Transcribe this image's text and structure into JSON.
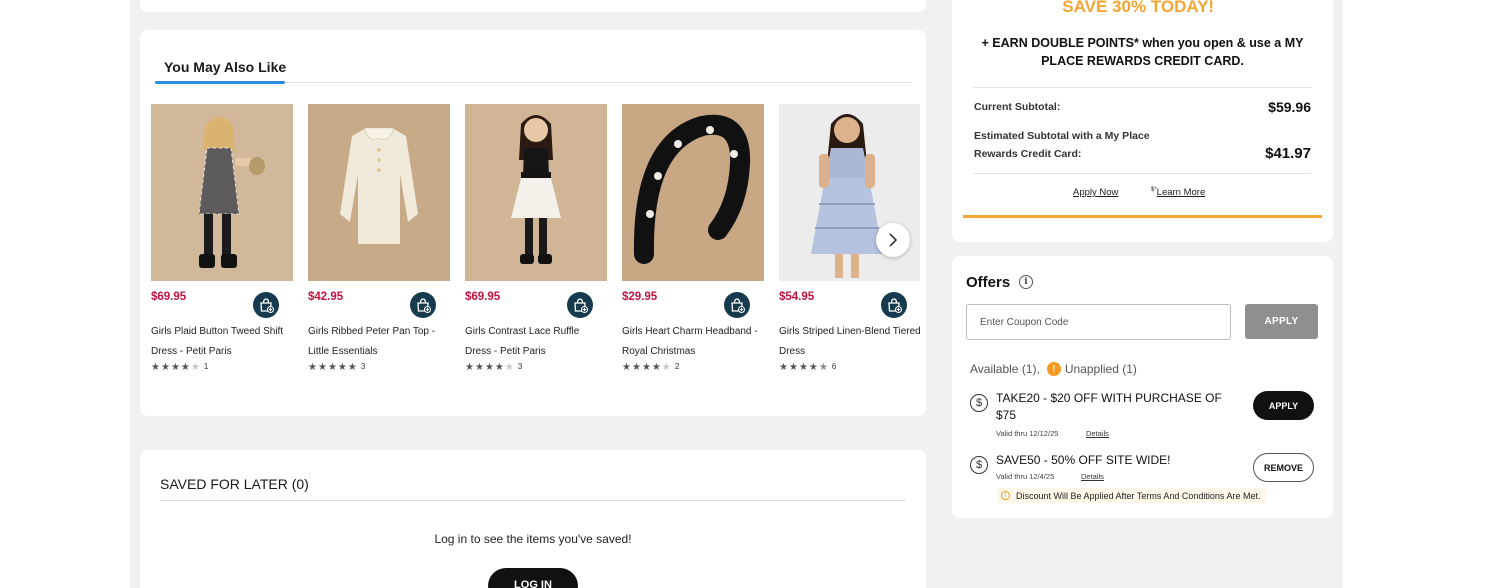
{
  "recommendations": {
    "title": "You May Also Like",
    "products": [
      {
        "price": "$69.95",
        "name": "Girls Plaid Button Tweed Shift Dress - Petit Paris",
        "rating": 4,
        "rating_count": "1",
        "image": "girl-plaid-dress"
      },
      {
        "price": "$42.95",
        "name": "Girls Ribbed Peter Pan Top - Little Essentials",
        "rating": 5,
        "rating_count": "3",
        "image": "ribbed-top"
      },
      {
        "price": "$69.95",
        "name": "Girls Contrast Lace Ruffle Dress - Petit Paris",
        "rating": 4.5,
        "rating_count": "3",
        "image": "girl-lace-dress"
      },
      {
        "price": "$29.95",
        "name": "Girls Heart Charm Headband - Royal Christmas",
        "rating": 4,
        "rating_count": "2",
        "image": "headband"
      },
      {
        "price": "$54.95",
        "name": "Girls Striped Linen-Blend Tiered Dress",
        "rating": 4.5,
        "rating_count": "6",
        "image": "girl-tiered-dress"
      }
    ],
    "add_to_bag_icon": "bag-plus-icon",
    "next_icon": "chevron-right-icon"
  },
  "saved_for_later": {
    "title": "SAVED FOR LATER (0)",
    "message": "Log in to see the items you've saved!",
    "login_label": "LOG IN"
  },
  "promo": {
    "headline": "SAVE 30% TODAY!",
    "headline_mark": "*",
    "earn_text": "+ EARN DOUBLE POINTS* when you open & use a MY PLACE REWARDS CREDIT CARD.",
    "current_subtotal_label": "Current Subtotal:",
    "current_subtotal_value": "$59.96",
    "estimated_label": "Estimated Subtotal with a My Place Rewards Credit Card:",
    "estimated_value": "$41.97",
    "apply_now": "Apply Now",
    "learn_more_mark": "$*",
    "learn_more": "Learn More",
    "accent_color": "#f5a531"
  },
  "offers": {
    "title": "Offers",
    "coupon_placeholder": "Enter Coupon Code",
    "apply_label": "APPLY",
    "available_text": "Available (1),",
    "unapplied_text": "Unapplied (1)",
    "items": [
      {
        "title": "TAKE20 - $20 OFF WITH PURCHASE OF $75",
        "valid": "Valid thru 12/12/25",
        "details": "Details",
        "action": "APPLY"
      },
      {
        "title": "SAVE50 - 50% OFF SITE WIDE!",
        "valid": "Valid thru 12/4/25",
        "details": "Details",
        "action": "REMOVE"
      }
    ],
    "terms_note": "Discount Will Be Applied After Terms And Conditions Are Met."
  }
}
